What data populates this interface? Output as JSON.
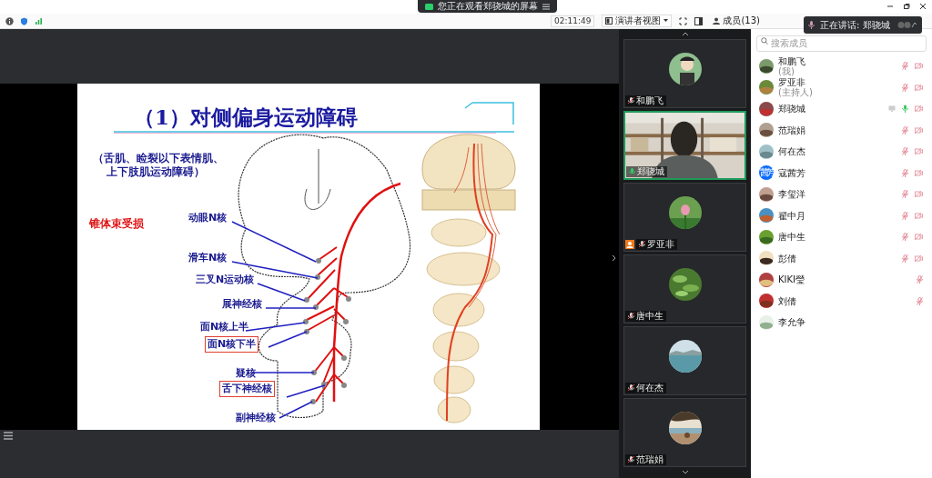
{
  "notice": "您正在观看郑骁城的屏幕",
  "toolbar": {
    "timer": "02:11:49",
    "view": "演讲者视图",
    "members": "成员(13)"
  },
  "speaking": "正在讲话: 郑骁城",
  "slide": {
    "title": "（1）对侧偏身运动障碍",
    "subtitle": [
      "（舌肌、睑裂以下表情肌、",
      "上下肢肌运动障碍）"
    ],
    "lesion": "锥体束受损",
    "labels": [
      {
        "text": "动眼N核",
        "boxed": false
      },
      {
        "text": "滑车N核",
        "boxed": false
      },
      {
        "text": "三叉N运动核",
        "boxed": false
      },
      {
        "text": "展神经核",
        "boxed": false
      },
      {
        "text": "面N核上半",
        "boxed": false
      },
      {
        "text": "面N核下半",
        "boxed": true
      },
      {
        "text": "疑核",
        "boxed": false
      },
      {
        "text": "舌下神经核",
        "boxed": true
      },
      {
        "text": "副神经核",
        "boxed": false
      }
    ]
  },
  "videos": [
    {
      "name": "和鹏飞",
      "kind": "avatar",
      "selected": false,
      "host": false,
      "muted": true
    },
    {
      "name": "郑骁城",
      "kind": "camera",
      "selected": true,
      "host": false,
      "muted": false
    },
    {
      "name": "罗亚非",
      "kind": "flower",
      "selected": false,
      "host": true,
      "muted": true
    },
    {
      "name": "唐中生",
      "kind": "leaves",
      "selected": false,
      "host": false,
      "muted": true
    },
    {
      "name": "何在杰",
      "kind": "lake",
      "selected": false,
      "host": false,
      "muted": true
    },
    {
      "name": "范瑞娟",
      "kind": "beach",
      "selected": false,
      "host": false,
      "muted": true
    }
  ],
  "member_search": {
    "placeholder": "搜索成员"
  },
  "members": [
    {
      "name": "和鹏飞",
      "role": "(我)",
      "kind": "picture",
      "muted": true,
      "camera_off": true,
      "sharing": false
    },
    {
      "name": "罗亚非",
      "role": "(主持人)",
      "kind": "picture",
      "muted": true,
      "camera_off": true,
      "sharing": false
    },
    {
      "name": "郑骁城",
      "kind": "picture",
      "muted": false,
      "camera_off": true,
      "sharing": true
    },
    {
      "name": "范瑞娟",
      "kind": "picture",
      "muted": true,
      "camera_off": true,
      "sharing": false
    },
    {
      "name": "何在杰",
      "kind": "picture",
      "muted": true,
      "camera_off": true,
      "sharing": false
    },
    {
      "name": "寇茜芳",
      "kind": "initials",
      "avatar_text": "茜芳",
      "muted": true,
      "camera_off": true,
      "sharing": false
    },
    {
      "name": "李玺洋",
      "kind": "picture",
      "muted": true,
      "camera_off": true,
      "sharing": false
    },
    {
      "name": "翟中月",
      "kind": "picture",
      "muted": true,
      "camera_off": true,
      "sharing": false
    },
    {
      "name": "唐中生",
      "kind": "picture",
      "muted": true,
      "camera_off": true,
      "sharing": false
    },
    {
      "name": "彭倩",
      "kind": "picture",
      "muted": true,
      "camera_off": true,
      "sharing": false
    },
    {
      "name": "KIKI瑩",
      "kind": "picture",
      "muted": true,
      "camera_off": false,
      "sharing": false
    },
    {
      "name": "刘倩",
      "kind": "picture",
      "muted": true,
      "camera_off": false,
      "sharing": false
    },
    {
      "name": "李允争",
      "kind": "picture",
      "camera_off": false,
      "sharing": false
    }
  ]
}
